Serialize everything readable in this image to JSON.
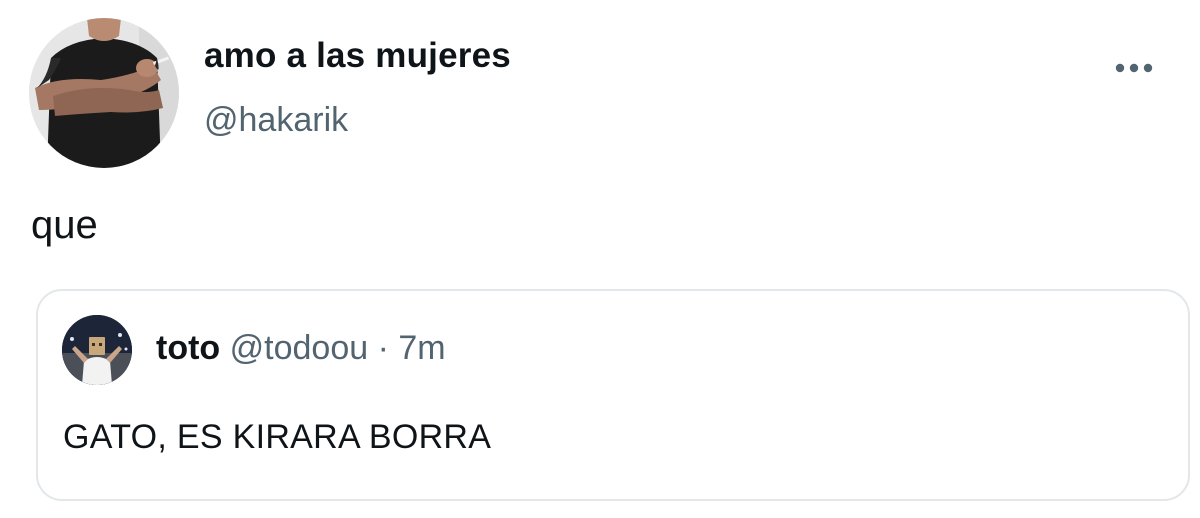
{
  "tweet": {
    "author": {
      "display_name": "amo a las mujeres",
      "handle": "@hakarik",
      "avatar_icon": "profile-photo-man-crossed-arms"
    },
    "text": "que",
    "more_icon": "more-horizontal-icon"
  },
  "quoted_tweet": {
    "author": {
      "display_name": "toto",
      "handle": "@todoou",
      "avatar_icon": "profile-photo-person-bag-head"
    },
    "separator": "·",
    "time": "7m",
    "text": "GATO, ES KIRARA BORRA"
  },
  "colors": {
    "primary_text": "#0f1419",
    "secondary_text": "#536471",
    "border": "#e3e7ea",
    "background": "#ffffff"
  }
}
